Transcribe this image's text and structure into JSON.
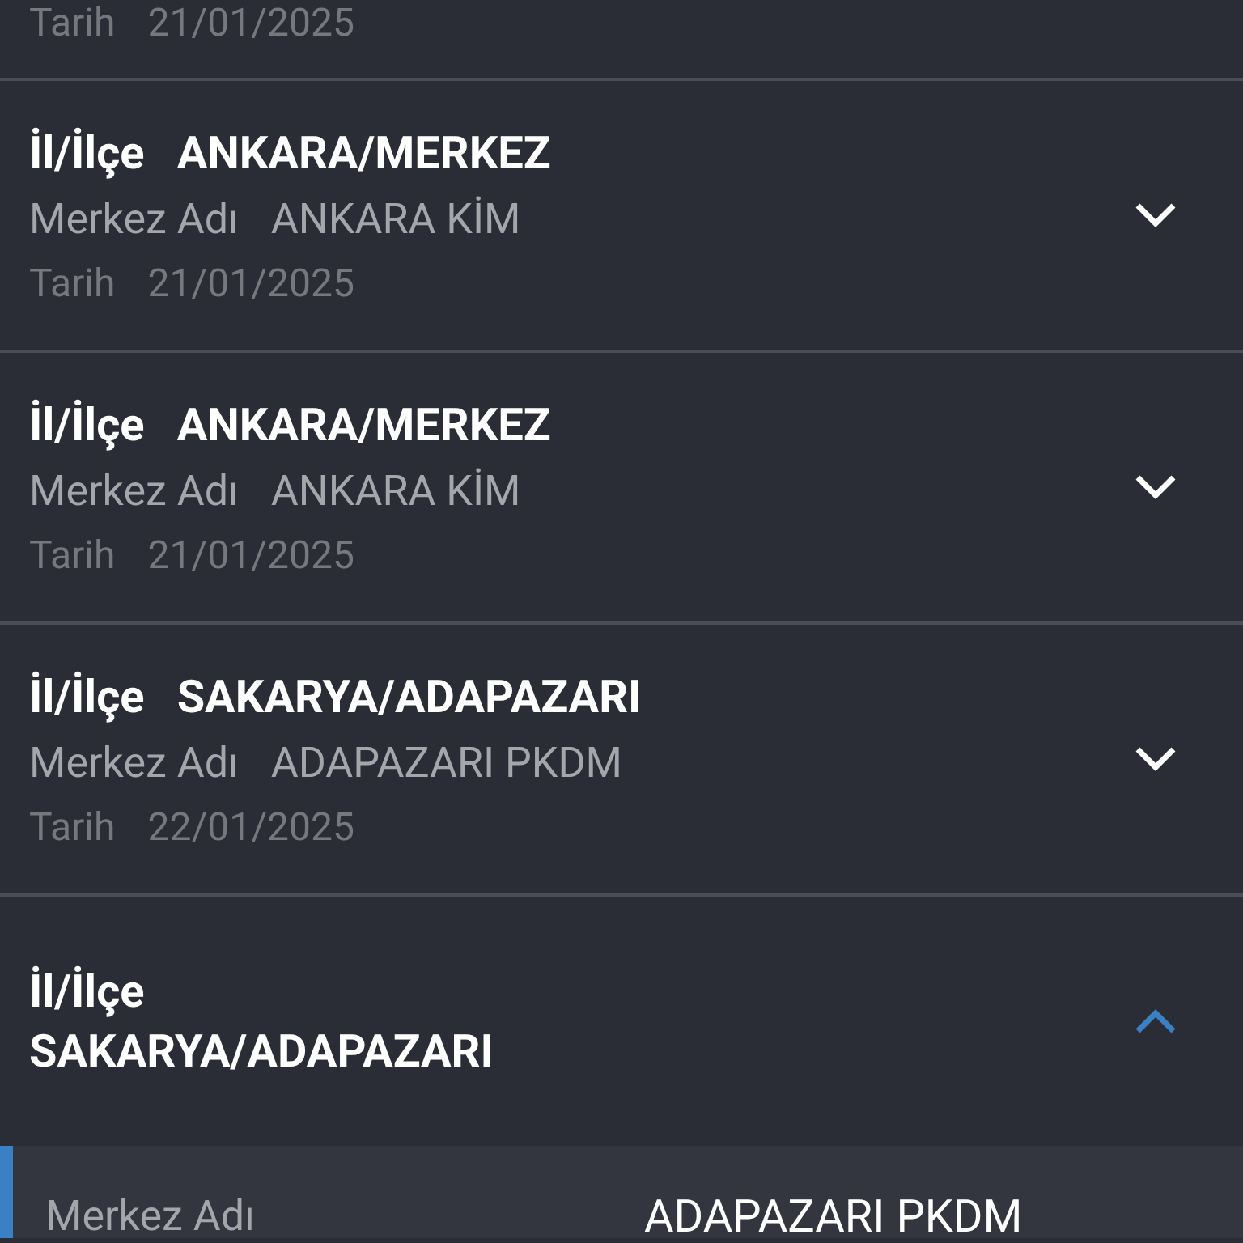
{
  "top_item": {
    "date_label": "Tarih",
    "date": "21/01/2025"
  },
  "items": [
    {
      "region_label": "İl/İlçe",
      "region": "ANKARA/MERKEZ",
      "center_label": "Merkez Adı",
      "center": "ANKARA KİM",
      "date_label": "Tarih",
      "date": "21/01/2025",
      "expanded": false
    },
    {
      "region_label": "İl/İlçe",
      "region": "ANKARA/MERKEZ",
      "center_label": "Merkez Adı",
      "center": "ANKARA KİM",
      "date_label": "Tarih",
      "date": "21/01/2025",
      "expanded": false
    },
    {
      "region_label": "İl/İlçe",
      "region": "SAKARYA/ADAPAZARI",
      "center_label": "Merkez Adı",
      "center": "ADAPAZARI PKDM",
      "date_label": "Tarih",
      "date": "22/01/2025",
      "expanded": false
    },
    {
      "region_label": "İl/İlçe",
      "region": "SAKARYA/ADAPAZARI",
      "expanded": true,
      "details": [
        {
          "label": "Merkez Adı",
          "value": "ADAPAZARI PKDM"
        }
      ]
    }
  ]
}
